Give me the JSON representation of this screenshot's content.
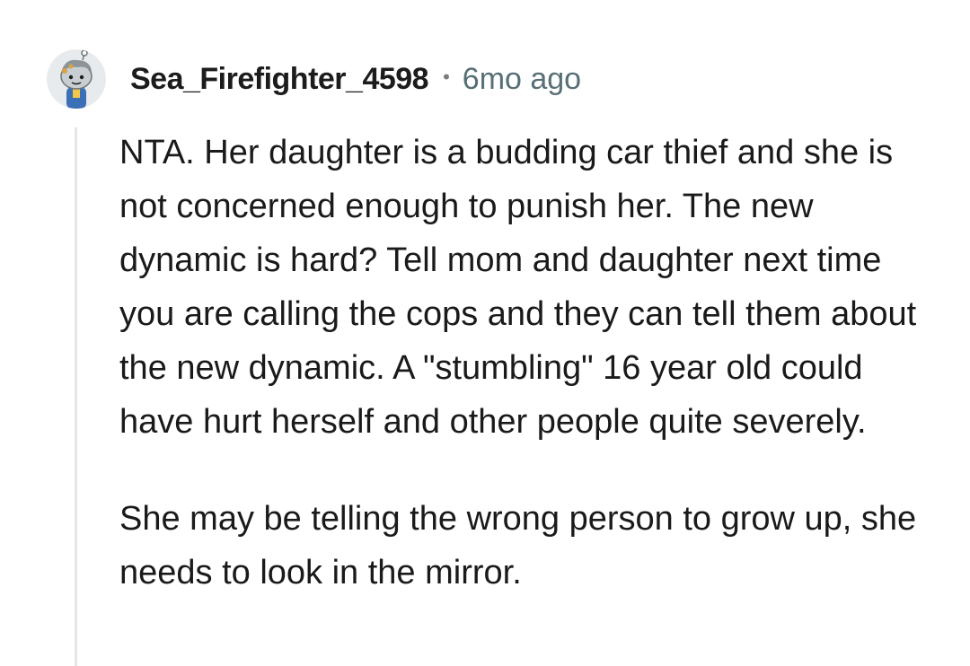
{
  "comment": {
    "author": {
      "username": "Sea_Firefighter_4598",
      "avatar_icon": "reddit-snoo-avatar-icon"
    },
    "separator": "•",
    "timestamp": "6mo ago",
    "paragraphs": [
      "NTA. Her daughter is a budding car thief and she is not concerned enough to punish her. The new dynamic is hard? Tell mom and daughter next time you are calling the cops and they can tell them about the new dynamic. A \"stumbling\" 16 year old could have hurt herself and other people quite severely.",
      "She may be telling the wrong person to grow up, she needs to look in the mirror."
    ]
  },
  "colors": {
    "username": "#1c1c1c",
    "timestamp": "#576f76",
    "body": "#1a1a1b",
    "thread_line": "#e4e6e8",
    "avatar_bg": "#e8ebed"
  }
}
